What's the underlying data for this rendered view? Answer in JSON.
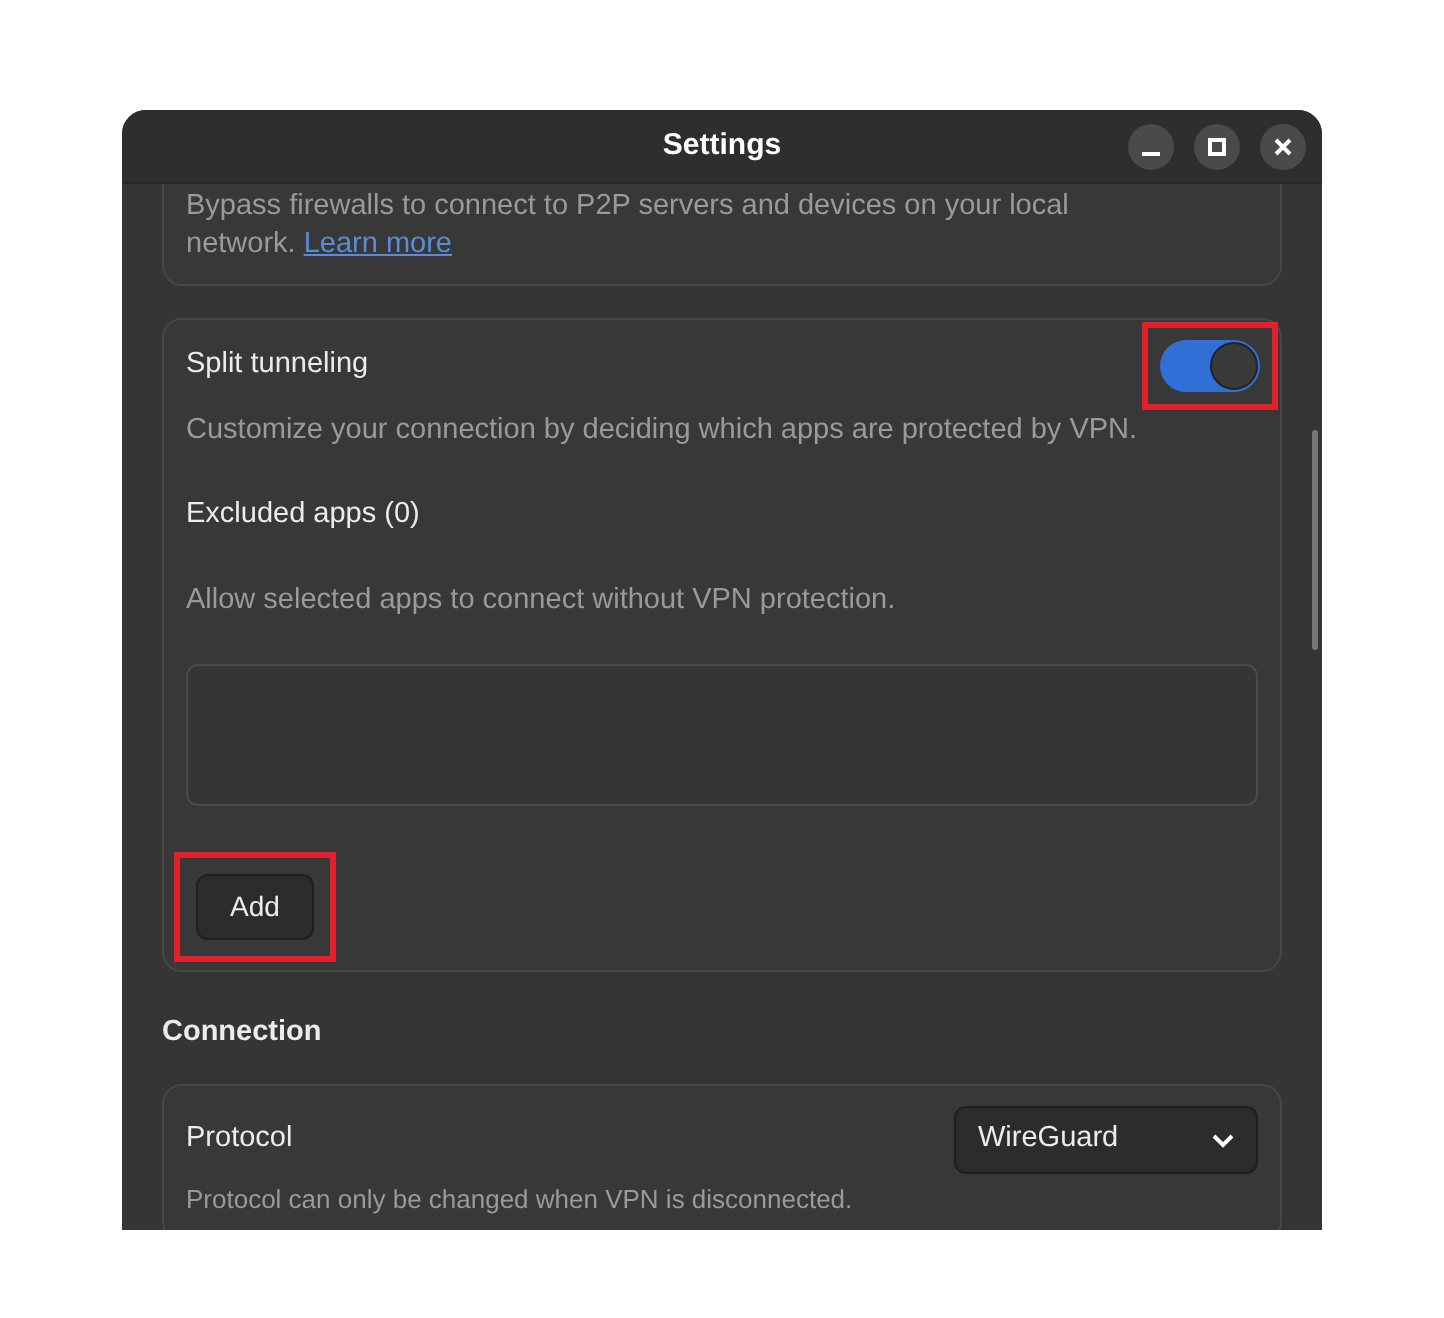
{
  "window": {
    "title": "Settings"
  },
  "local_network": {
    "description": "Bypass firewalls to connect to P2P servers and devices on your local network.",
    "link": "Learn more"
  },
  "split_tunneling": {
    "label": "Split tunneling",
    "on": true,
    "highlighted": true,
    "description": "Customize your connection by deciding which apps are protected by VPN.",
    "excluded_title": "Excluded apps (0)",
    "excluded_description": "Allow selected apps to connect without VPN protection.",
    "add_button": {
      "label": "Add",
      "highlighted": true
    }
  },
  "connection": {
    "heading": "Connection",
    "protocol_label": "Protocol",
    "protocol_value": "WireGuard",
    "protocol_note": "Protocol can only be changed when VPN is disconnected."
  }
}
